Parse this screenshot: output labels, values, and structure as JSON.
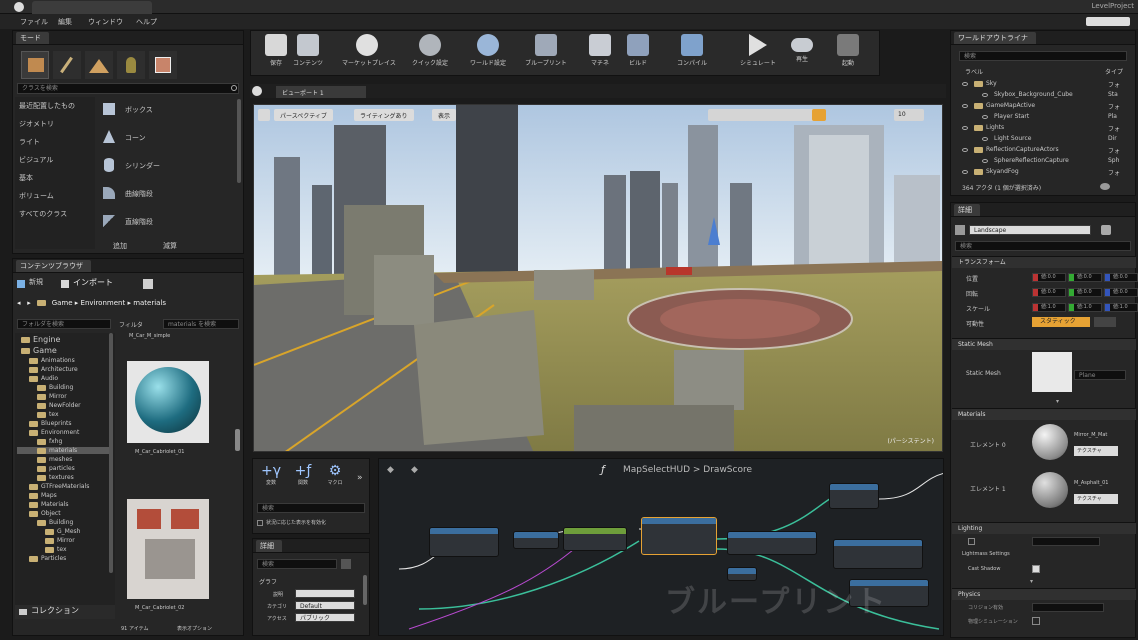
{
  "title_bar": {
    "project": "LevelProject"
  },
  "menu": [
    "ファイル",
    "編集",
    "ウィンドウ",
    "ヘルプ"
  ],
  "modes_panel": {
    "tab": "モード",
    "search_placeholder": "クラスを検索",
    "categories": [
      "最近配置したもの",
      "ジオメトリ",
      "ライト",
      "ビジュアル",
      "基本",
      "ボリューム",
      "すべてのクラス"
    ],
    "items": [
      "ボックス",
      "コーン",
      "シリンダー",
      "曲線階段",
      "直線階段"
    ],
    "footer": [
      "追加",
      "減算"
    ]
  },
  "toolbar": {
    "buttons": [
      {
        "label": "保存",
        "icon": "save-icon"
      },
      {
        "label": "コンテンツ",
        "icon": "content-icon"
      },
      {
        "label": "マーケットプレイス",
        "icon": "marketplace-icon"
      },
      {
        "label": "クイック設定",
        "icon": "settings-icon"
      },
      {
        "label": "ワールド設定",
        "icon": "world-icon"
      },
      {
        "label": "ブループリント",
        "icon": "blueprint-icon"
      },
      {
        "label": "マチネ",
        "icon": "matinee-icon"
      },
      {
        "label": "ビルド",
        "icon": "build-icon"
      },
      {
        "label": "コンパイル",
        "icon": "compile-icon"
      },
      {
        "label": "シミュレート",
        "icon": "play-icon"
      },
      {
        "label": "再生",
        "icon": "gamepad-icon"
      },
      {
        "label": "起動",
        "icon": "launch-icon"
      }
    ]
  },
  "viewport": {
    "tab": "ビューポート 1",
    "mode_buttons": [
      "パースペクティブ",
      "ライティングあり",
      "表示"
    ],
    "overlay_label": "(パーシステント)",
    "top_right_num": "10"
  },
  "content_browser": {
    "tab": "コンテンツブラウザ",
    "add_new": "新規",
    "import": "インポート",
    "path": [
      "Game",
      "Environment",
      "materials"
    ],
    "search_placeholder": "フォルダを検索",
    "filter_label": "フィルタ",
    "asset_search_placeholder": "materials を検索",
    "tree": [
      "Engine",
      "Game",
      "Animations",
      "Architecture",
      "Audio",
      "Building",
      "Mirror",
      "NewFolder",
      "tex",
      "Blueprints",
      "Environment",
      "fxhg",
      "materials",
      "meshes",
      "particles",
      "textures",
      "GTFreeMaterials",
      "Maps",
      "Materials",
      "Object",
      "Building",
      "G_Mesh",
      "Mirror",
      "tex",
      "Particles"
    ],
    "assets": [
      {
        "name": "M_Car_M_simple",
        "label": "M_Car_Cabriolet_01"
      },
      {
        "name": "M_Car_Cabriolet_02",
        "label": "M_Car_Cabriolet_02"
      }
    ],
    "footer_count": "91 アイテム",
    "view_options": "表示オプション",
    "collections": "コレクション"
  },
  "palette": {
    "items": [
      "変数",
      "関数",
      "マクロ"
    ],
    "search_placeholder": "検索",
    "context_check": "状況に応じた表示を有効化"
  },
  "details_bp": {
    "tab": "詳細",
    "search_placeholder": "検索",
    "section": "グラフ",
    "rows": [
      {
        "label": "説明",
        "value": ""
      },
      {
        "label": "カテゴリ",
        "value": "Default"
      },
      {
        "label": "アクセス",
        "value": "パブリック"
      }
    ]
  },
  "graph": {
    "breadcrumb": "MapSelectHUD > DrawScore",
    "watermark": "ブループリント"
  },
  "outliner": {
    "tab": "ワールドアウトライナ",
    "search_placeholder": "検索",
    "col_label": "ラベル",
    "col_type": "タイプ",
    "rows": [
      {
        "label": "Sky",
        "type": "フォ",
        "indent": 0
      },
      {
        "label": "Skybox_Background_Cube",
        "type": "Sta",
        "indent": 2
      },
      {
        "label": "GameMapActive",
        "type": "フォ",
        "indent": 0
      },
      {
        "label": "Player Start",
        "type": "Pla",
        "indent": 2
      },
      {
        "label": "Lights",
        "type": "フォ",
        "indent": 0
      },
      {
        "label": "Light Source",
        "type": "Dir",
        "indent": 2
      },
      {
        "label": "ReflectionCaptureActors",
        "type": "フォ",
        "indent": 0
      },
      {
        "label": "SphereReflectionCapture",
        "type": "Sph",
        "indent": 2
      },
      {
        "label": "SkyandFog",
        "type": "フォ",
        "indent": 0
      }
    ],
    "footer": "364 アクタ (1 個が選択済み)"
  },
  "details": {
    "tab": "詳細",
    "search_placeholder": "検索",
    "selected_actor": "Landscape",
    "sections": {
      "transform": "トランスフォーム",
      "static_mesh": "Static Mesh",
      "materials": "Materials",
      "lighting": "Lighting",
      "physics": "Physics"
    },
    "transform_rows": [
      "位置",
      "回転",
      "スケール",
      "可動性"
    ],
    "transform_values": [
      [
        "値:0.0",
        "値:0.0",
        "値:0.0"
      ],
      [
        "値:0.0",
        "値:0.0",
        "値:0.0"
      ],
      [
        "値:1.0",
        "値:1.0",
        "値:1.0"
      ]
    ],
    "mobility": "スタティック",
    "static_mesh_label": "Static Mesh",
    "static_mesh_value": "Plane",
    "material_rows": [
      {
        "label": "エレメント 0",
        "value": "Mirror_M_Mat",
        "btn": "テクスチャ"
      },
      {
        "label": "エレメント 1",
        "value": "M_Asphalt_01",
        "btn": "テクスチャ"
      }
    ],
    "lighting_rows": [
      "Lightmass Settings",
      "Cast Shadow"
    ],
    "physics_rows": [
      "コリジョン有効",
      "物理シミュレーション"
    ]
  }
}
